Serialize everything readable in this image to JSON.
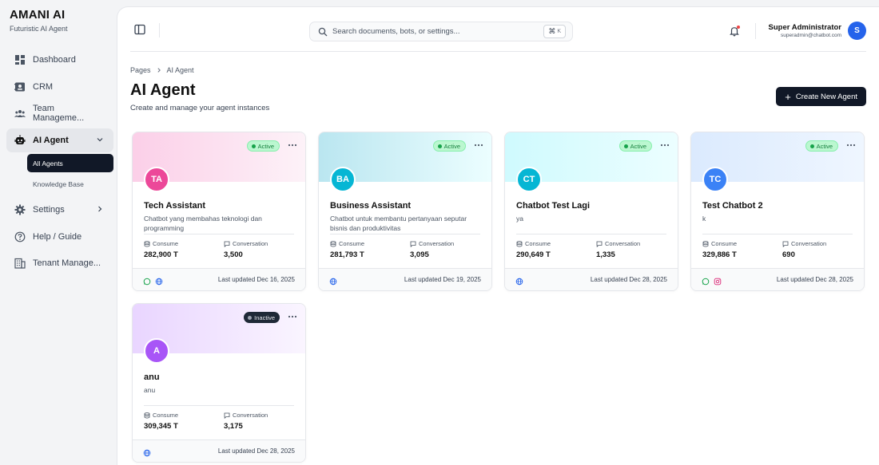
{
  "brand": {
    "title": "AMANI AI",
    "subtitle": "Futuristic AI Agent"
  },
  "sidebar": {
    "items": [
      {
        "label": "Dashboard",
        "icon": "dashboard-icon"
      },
      {
        "label": "CRM",
        "icon": "contact-card-icon"
      },
      {
        "label": "Team Manageme...",
        "icon": "team-icon"
      },
      {
        "label": "AI Agent",
        "icon": "robot-icon",
        "expanded": true,
        "children": [
          {
            "label": "All Agents",
            "active": true
          },
          {
            "label": "Knowledge Base"
          }
        ]
      },
      {
        "label": "Settings",
        "icon": "gear-icon"
      },
      {
        "label": "Help / Guide",
        "icon": "help-icon"
      },
      {
        "label": "Tenant Manage...",
        "icon": "building-icon"
      }
    ]
  },
  "header": {
    "search_placeholder": "Search documents, bots, or settings...",
    "shortcut_symbol": "⌘",
    "shortcut_key": "K",
    "user": {
      "name": "Super Administrator",
      "email": "superadmin@chatbot.com",
      "initial": "S"
    }
  },
  "page": {
    "breadcrumb": [
      "Pages",
      "AI Agent"
    ],
    "title": "AI Agent",
    "subtitle": "Create and manage your agent instances",
    "create_label": "Create New Agent"
  },
  "labels": {
    "consume": "Consume",
    "conversation": "Conversation"
  },
  "agents": [
    {
      "initials": "TA",
      "name": "Tech Assistant",
      "description": "Chatbot yang membahas teknologi dan programming",
      "status": "Active",
      "consume": "282,900 T",
      "conversation": "3,500",
      "updated": "Last updated Dec 16, 2025",
      "channels": [
        "chat-icon",
        "globe-icon"
      ],
      "avatar_color": "#ec4899",
      "header_gradient": [
        "#fbcfe8",
        "#fdf2f8"
      ]
    },
    {
      "initials": "BA",
      "name": "Business Assistant",
      "description": "Chatbot untuk membantu pertanyaan seputar bisnis dan produktivitas",
      "status": "Active",
      "consume": "281,793 T",
      "conversation": "3,095",
      "updated": "Last updated Dec 19, 2025",
      "channels": [
        "globe-icon"
      ],
      "avatar_color": "#06b6d4",
      "header_gradient": [
        "#bae6f0",
        "#ecfeff"
      ]
    },
    {
      "initials": "CT",
      "name": "Chatbot Test Lagi",
      "description": "ya",
      "status": "Active",
      "consume": "290,649 T",
      "conversation": "1,335",
      "updated": "Last updated Dec 28, 2025",
      "channels": [
        "globe-icon"
      ],
      "avatar_color": "#06b6d4",
      "header_gradient": [
        "#cffafe",
        "#ecfeff"
      ]
    },
    {
      "initials": "TC",
      "name": "Test Chatbot 2",
      "description": "k",
      "status": "Active",
      "consume": "329,886 T",
      "conversation": "690",
      "updated": "Last updated Dec 28, 2025",
      "channels": [
        "chat-icon",
        "instagram-icon"
      ],
      "avatar_color": "#3b82f6",
      "header_gradient": [
        "#dbeafe",
        "#eff6ff"
      ]
    },
    {
      "initials": "A",
      "name": "anu",
      "description": "anu",
      "status": "Inactive",
      "consume": "309,345 T",
      "conversation": "3,175",
      "updated": "Last updated Dec 28, 2025",
      "channels": [
        "globe-icon"
      ],
      "avatar_color": "#a855f7",
      "header_gradient": [
        "#e9d5ff",
        "#faf5ff"
      ]
    }
  ]
}
